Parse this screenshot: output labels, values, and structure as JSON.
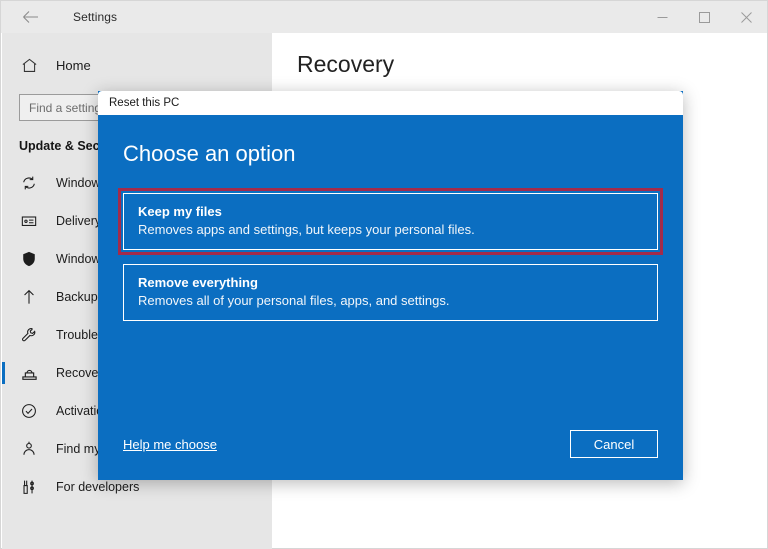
{
  "window": {
    "title": "Settings",
    "back_icon": "back-arrow-icon",
    "controls": {
      "minimize": "minimize-icon",
      "maximize": "maximize-icon",
      "close": "close-icon"
    }
  },
  "sidebar": {
    "home_label": "Home",
    "home_icon": "home-icon",
    "search": {
      "value": "",
      "placeholder": "Find a setting"
    },
    "section_title": "Update & Security",
    "items": [
      {
        "label": "Windows Update",
        "icon": "sync-icon",
        "selected": false
      },
      {
        "label": "Delivery Optimization",
        "icon": "delivery-icon",
        "selected": false
      },
      {
        "label": "Windows Security",
        "icon": "shield-icon",
        "selected": false
      },
      {
        "label": "Backup",
        "icon": "upload-arrow-icon",
        "selected": false
      },
      {
        "label": "Troubleshoot",
        "icon": "wrench-icon",
        "selected": false
      },
      {
        "label": "Recovery",
        "icon": "recovery-icon",
        "selected": true
      },
      {
        "label": "Activation",
        "icon": "check-circle-icon",
        "selected": false
      },
      {
        "label": "Find my device",
        "icon": "find-device-icon",
        "selected": false
      },
      {
        "label": "For developers",
        "icon": "developer-tools-icon",
        "selected": false
      }
    ]
  },
  "main": {
    "page_title": "Recovery"
  },
  "dialog": {
    "title": "Reset this PC",
    "heading": "Choose an option",
    "options": [
      {
        "title": "Keep my files",
        "desc": "Removes apps and settings, but keeps your personal files.",
        "focused": true
      },
      {
        "title": "Remove everything",
        "desc": "Removes all of your personal files, apps, and settings.",
        "focused": false
      }
    ],
    "help_link": "Help me choose",
    "cancel_label": "Cancel"
  },
  "colors": {
    "dialog_blue": "#0b6ec1",
    "sidebar_gray": "#e6e6e6",
    "titlebar_gray": "#eaeaea",
    "focus_red": "#a32b4b",
    "accent": "#0b6ec1"
  }
}
